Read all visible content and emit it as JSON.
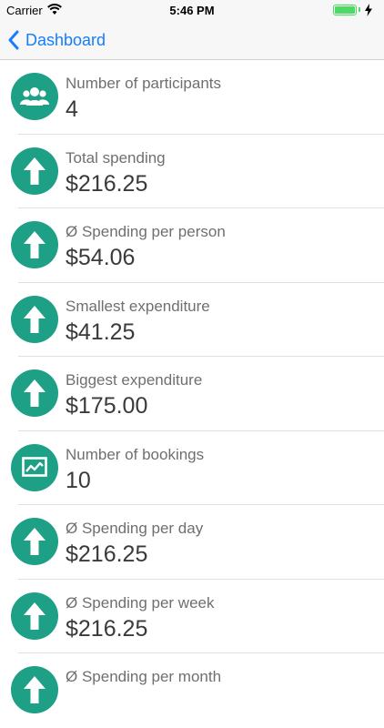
{
  "status_bar": {
    "carrier": "Carrier",
    "time": "5:46 PM"
  },
  "nav": {
    "back_label": "Dashboard"
  },
  "colors": {
    "accent": "#1da086",
    "link": "#157efb"
  },
  "stats": [
    {
      "icon": "people-icon",
      "label": "Number of participants",
      "value": "4"
    },
    {
      "icon": "arrow-up-icon",
      "label": "Total spending",
      "value": "$216.25"
    },
    {
      "icon": "arrow-up-icon",
      "label": "Ø Spending per person",
      "value": "$54.06"
    },
    {
      "icon": "arrow-up-icon",
      "label": "Smallest expenditure",
      "value": "$41.25"
    },
    {
      "icon": "arrow-up-icon",
      "label": "Biggest expenditure",
      "value": "$175.00"
    },
    {
      "icon": "chart-icon",
      "label": "Number of bookings",
      "value": "10"
    },
    {
      "icon": "arrow-up-icon",
      "label": "Ø Spending per day",
      "value": "$216.25"
    },
    {
      "icon": "arrow-up-icon",
      "label": "Ø Spending per week",
      "value": "$216.25"
    },
    {
      "icon": "arrow-up-icon",
      "label": "Ø Spending per month",
      "value": ""
    }
  ]
}
